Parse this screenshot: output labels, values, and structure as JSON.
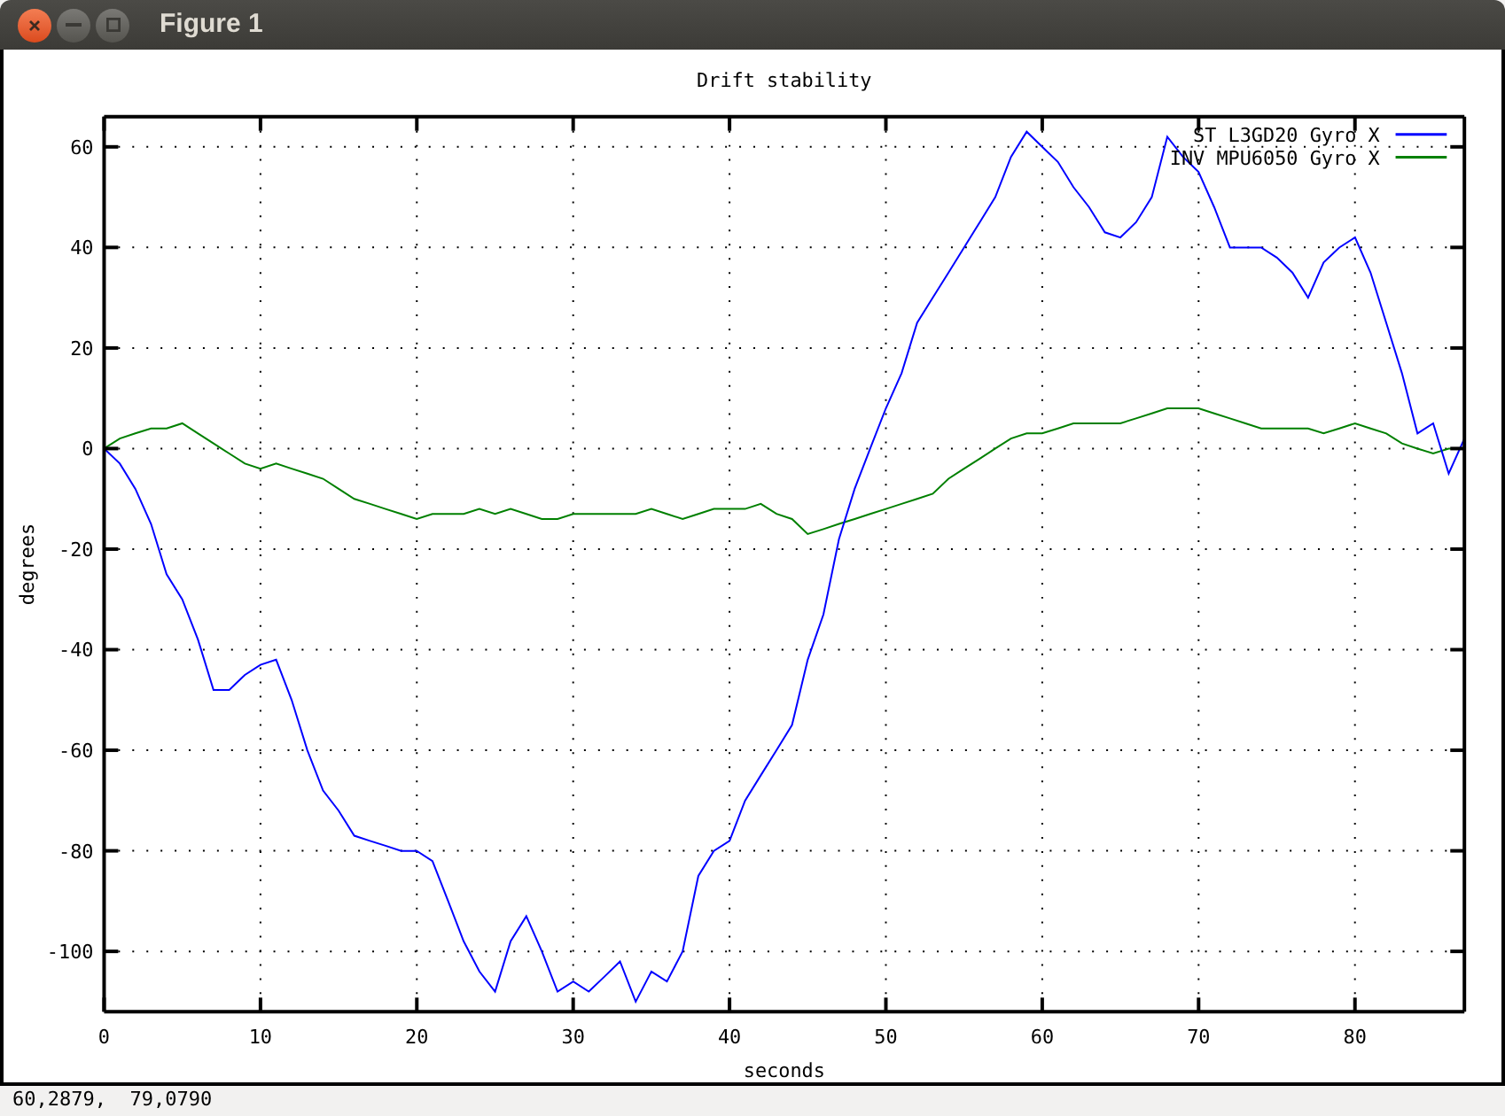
{
  "window": {
    "title": "Figure 1"
  },
  "figure": {
    "chart_data": {
      "type": "line",
      "title": "Drift stability",
      "grid": true,
      "legend": true,
      "xlabel": "seconds",
      "ylabel": "degrees",
      "xlim": [
        0,
        87
      ],
      "ylim": [
        -112,
        66
      ],
      "xticks": [
        0,
        10,
        20,
        30,
        40,
        50,
        60,
        70,
        80
      ],
      "yticks": [
        -100,
        -80,
        -60,
        -40,
        -20,
        0,
        20,
        40,
        60
      ],
      "x": [
        0,
        1,
        2,
        3,
        4,
        5,
        6,
        7,
        8,
        9,
        10,
        11,
        12,
        13,
        14,
        15,
        16,
        17,
        18,
        19,
        20,
        21,
        22,
        23,
        24,
        25,
        26,
        27,
        28,
        29,
        30,
        31,
        32,
        33,
        34,
        35,
        36,
        37,
        38,
        39,
        40,
        41,
        42,
        43,
        44,
        45,
        46,
        47,
        48,
        49,
        50,
        51,
        52,
        53,
        54,
        55,
        56,
        57,
        58,
        59,
        60,
        61,
        62,
        63,
        64,
        65,
        66,
        67,
        68,
        69,
        70,
        71,
        72,
        73,
        74,
        75,
        76,
        77,
        78,
        79,
        80,
        81,
        82,
        83,
        84,
        85,
        86,
        87
      ],
      "series": [
        {
          "name": "ST L3GD20 Gyro X",
          "color": "#0000ff",
          "values": [
            0,
            -3,
            -8,
            -15,
            -25,
            -30,
            -38,
            -48,
            -48,
            -45,
            -43,
            -42,
            -50,
            -60,
            -68,
            -72,
            -77,
            -78,
            -79,
            -80,
            -80,
            -82,
            -90,
            -98,
            -104,
            -108,
            -98,
            -93,
            -100,
            -108,
            -106,
            -108,
            -105,
            -102,
            -110,
            -104,
            -106,
            -100,
            -85,
            -80,
            -78,
            -70,
            -65,
            -60,
            -55,
            -42,
            -33,
            -18,
            -8,
            0,
            8,
            15,
            25,
            30,
            35,
            40,
            45,
            50,
            58,
            63,
            60,
            57,
            52,
            48,
            43,
            42,
            45,
            50,
            62,
            58,
            55,
            48,
            40,
            40,
            40,
            38,
            35,
            30,
            37,
            40,
            42,
            35,
            25,
            15,
            3,
            5,
            -5,
            2
          ]
        },
        {
          "name": "INV MPU6050 Gyro X",
          "color": "#008000",
          "values": [
            0,
            2,
            3,
            4,
            4,
            5,
            3,
            1,
            -1,
            -3,
            -4,
            -3,
            -4,
            -5,
            -6,
            -8,
            -10,
            -11,
            -12,
            -13,
            -14,
            -13,
            -13,
            -13,
            -12,
            -13,
            -12,
            -13,
            -14,
            -14,
            -13,
            -13,
            -13,
            -13,
            -13,
            -12,
            -13,
            -14,
            -13,
            -12,
            -12,
            -12,
            -11,
            -13,
            -14,
            -17,
            -16,
            -15,
            -14,
            -13,
            -12,
            -11,
            -10,
            -9,
            -6,
            -4,
            -2,
            0,
            2,
            3,
            3,
            4,
            5,
            5,
            5,
            5,
            6,
            7,
            8,
            8,
            8,
            7,
            6,
            5,
            4,
            4,
            4,
            4,
            3,
            4,
            5,
            4,
            3,
            1,
            0,
            -1,
            0,
            0
          ]
        }
      ]
    }
  },
  "status_bar": {
    "text": "60,2879,  79,0790"
  }
}
